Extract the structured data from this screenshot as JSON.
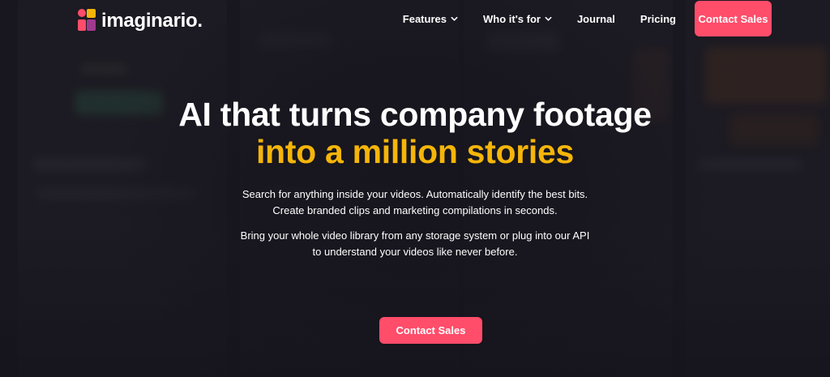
{
  "brand": {
    "name": "imaginario."
  },
  "nav": {
    "items": [
      {
        "label": "Features",
        "dropdown": true
      },
      {
        "label": "Who it's for",
        "dropdown": true
      },
      {
        "label": "Journal",
        "dropdown": false
      },
      {
        "label": "Pricing",
        "dropdown": false
      }
    ],
    "cta_label": "Contact Sales"
  },
  "hero": {
    "title_plain": "AI that turns company footage",
    "title_accent": "into a million stories",
    "subtitle_line1": "Search for anything inside your videos. Automatically identify the best bits.",
    "subtitle_line2": "Create branded clips and marketing compilations in seconds.",
    "body_line1": "Bring your whole video library from any storage system or plug into our API",
    "body_line2": "to understand your videos like never before.",
    "cta_label": "Contact Sales"
  },
  "colors": {
    "accent": "#f5b50a",
    "cta": "#ff4d6a",
    "background": "#1a1820"
  },
  "icons": {
    "dropdown": "chevron-down-icon",
    "logo": "logo-mark-icon"
  }
}
